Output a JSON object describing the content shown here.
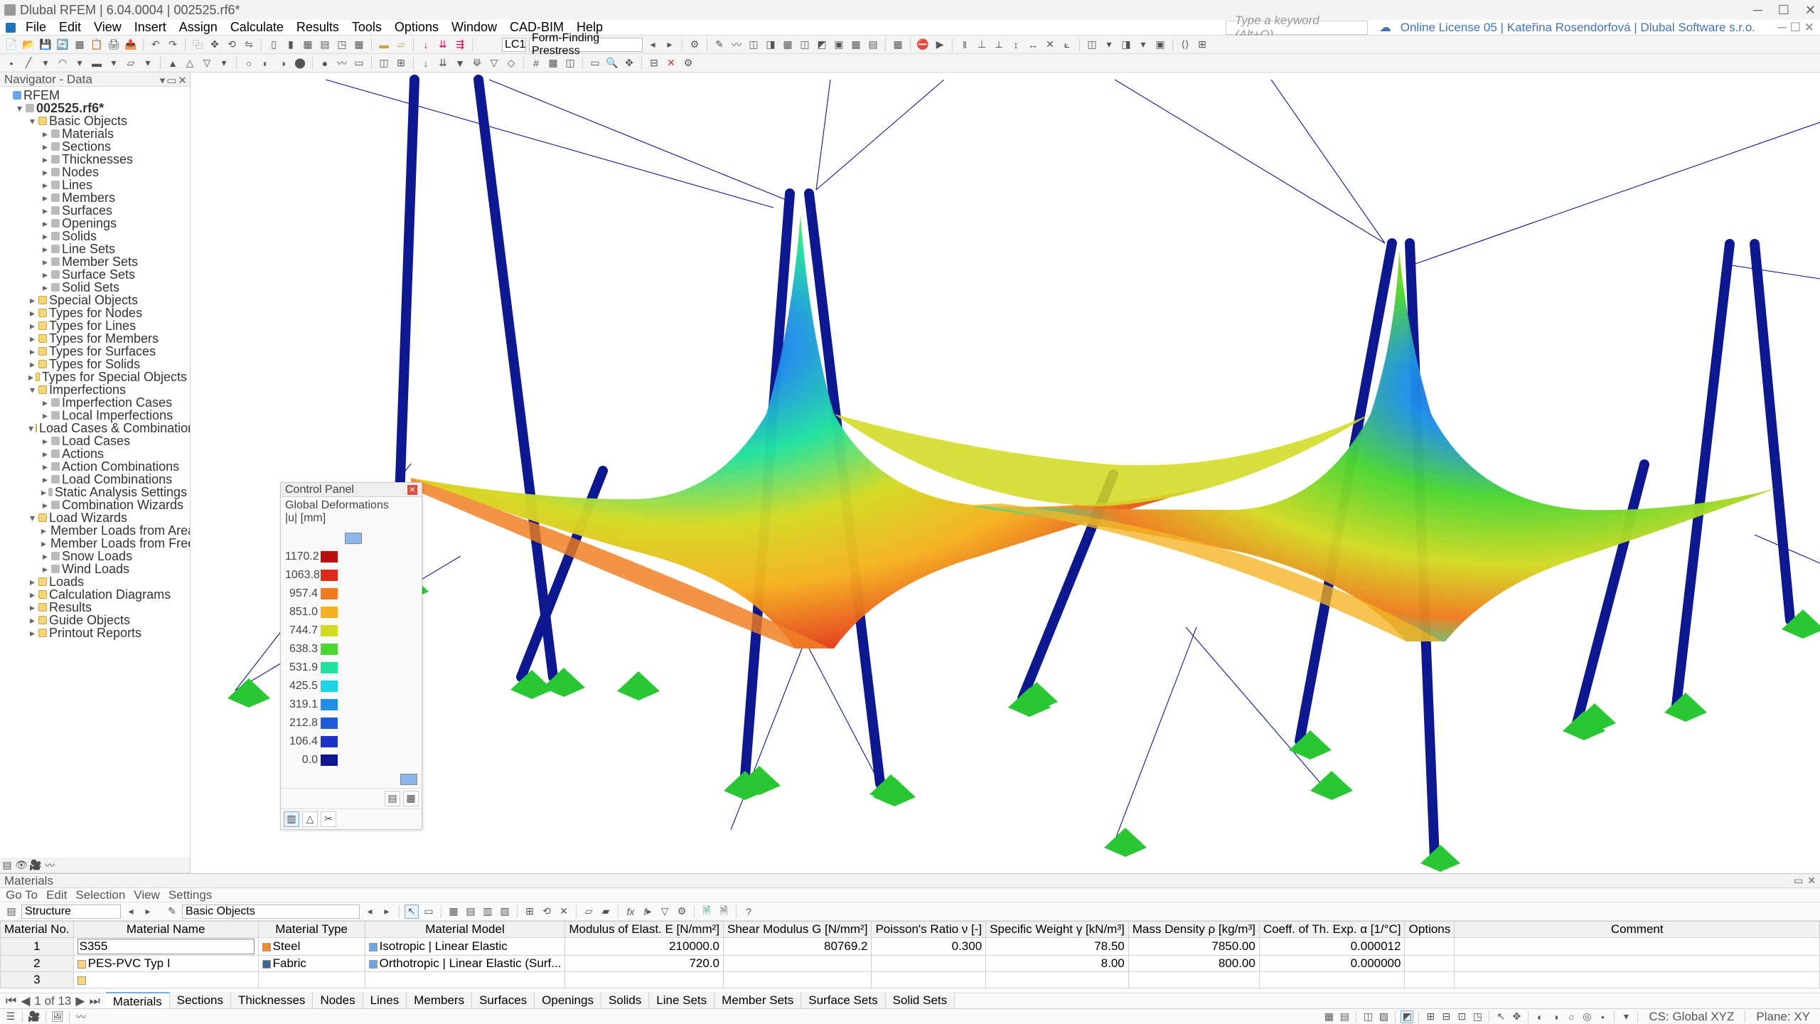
{
  "title": "Dlubal RFEM | 6.04.0004 | 002525.rf6*",
  "window_controls": [
    "─",
    "☐",
    "✕"
  ],
  "menus": [
    "File",
    "Edit",
    "View",
    "Insert",
    "Assign",
    "Calculate",
    "Results",
    "Tools",
    "Options",
    "Window",
    "CAD-BIM",
    "Help"
  ],
  "search_placeholder": "Type a keyword (Alt+Q)",
  "license": "Online License 05 | Kateřina Rosendorfová | Dlubal Software s.r.o.",
  "toolbar2": {
    "lc_label": "LC1",
    "lc_name": "Form-Finding Prestress"
  },
  "nav": {
    "title": "Navigator - Data",
    "root": "RFEM",
    "model": "002525.rf6*",
    "basic": {
      "label": "Basic Objects",
      "children": [
        "Materials",
        "Sections",
        "Thicknesses",
        "Nodes",
        "Lines",
        "Members",
        "Surfaces",
        "Openings",
        "Solids",
        "Line Sets",
        "Member Sets",
        "Surface Sets",
        "Solid Sets"
      ]
    },
    "top_groups": [
      "Special Objects",
      "Types for Nodes",
      "Types for Lines",
      "Types for Members",
      "Types for Surfaces",
      "Types for Solids",
      "Types for Special Objects"
    ],
    "imperfections": {
      "label": "Imperfections",
      "children": [
        "Imperfection Cases",
        "Local Imperfections"
      ]
    },
    "lcc": {
      "label": "Load Cases & Combinations",
      "children": [
        "Load Cases",
        "Actions",
        "Action Combinations",
        "Load Combinations",
        "Static Analysis Settings",
        "Combination Wizards"
      ]
    },
    "lw": {
      "label": "Load Wizards",
      "children": [
        "Member Loads from Area Load",
        "Member Loads from Free Line Load",
        "Snow Loads",
        "Wind Loads"
      ]
    },
    "bottom_groups": [
      "Loads",
      "Calculation Diagrams",
      "Results",
      "Guide Objects",
      "Printout Reports"
    ]
  },
  "ctrlpanel": {
    "title": "Control Panel",
    "result": "Global Deformations",
    "unit": "|u| [mm]",
    "scale": [
      {
        "v": "1170.2",
        "c": "#b80f0f"
      },
      {
        "v": "1063.8",
        "c": "#e2281b"
      },
      {
        "v": "957.4",
        "c": "#f07c1f"
      },
      {
        "v": "851.0",
        "c": "#f5b21e"
      },
      {
        "v": "744.7",
        "c": "#d3da22"
      },
      {
        "v": "638.3",
        "c": "#4bd631"
      },
      {
        "v": "531.9",
        "c": "#1fe29e"
      },
      {
        "v": "425.5",
        "c": "#1bd4e6"
      },
      {
        "v": "319.1",
        "c": "#1f8fe8"
      },
      {
        "v": "212.8",
        "c": "#1e5ade"
      },
      {
        "v": "106.4",
        "c": "#1b33c7"
      },
      {
        "v": "0.0",
        "c": "#0d178f"
      }
    ]
  },
  "materials": {
    "title": "Materials",
    "menu": [
      "Go To",
      "Edit",
      "Selection",
      "View",
      "Settings"
    ],
    "structure_label": "Structure",
    "group_label": "Basic Objects",
    "headers": {
      "no": "Material\nNo.",
      "name": "Material Name",
      "type": "Material\nType",
      "model": "Material Model",
      "E": "Modulus of Elast.\nE [N/mm²]",
      "G": "Shear Modulus\nG [N/mm²]",
      "nu": "Poisson's Ratio\nν [-]",
      "gamma": "Specific Weight\nγ [kN/m³]",
      "rho": "Mass Density\nρ [kg/m³]",
      "alpha": "Coeff. of Th. Exp.\nα [1/°C]",
      "opt": "Options",
      "comment": "Comment"
    },
    "rows": [
      {
        "no": "1",
        "name": "S355",
        "typeColor": "#f08c2a",
        "type": "Steel",
        "model": "Isotropic | Linear Elastic",
        "E": "210000.0",
        "G": "80769.2",
        "nu": "0.300",
        "gamma": "78.50",
        "rho": "7850.00",
        "alpha": "0.000012"
      },
      {
        "no": "2",
        "name": "PES-PVC Typ I",
        "typeColor": "#3a6690",
        "type": "Fabric",
        "model": "Orthotropic | Linear Elastic (Surf...",
        "E": "720.0",
        "G": "",
        "nu": "",
        "gamma": "8.00",
        "rho": "800.00",
        "alpha": "0.000000"
      },
      {
        "no": "3",
        "name": "",
        "type": "",
        "model": "",
        "E": "",
        "G": "",
        "nu": "",
        "gamma": "",
        "rho": "",
        "alpha": ""
      }
    ],
    "pager": "1 of 13",
    "tabs": [
      "Materials",
      "Sections",
      "Thicknesses",
      "Nodes",
      "Lines",
      "Members",
      "Surfaces",
      "Openings",
      "Solids",
      "Line Sets",
      "Member Sets",
      "Surface Sets",
      "Solid Sets"
    ]
  },
  "status": {
    "cs": "CS: Global XYZ",
    "plane": "Plane: XY"
  }
}
